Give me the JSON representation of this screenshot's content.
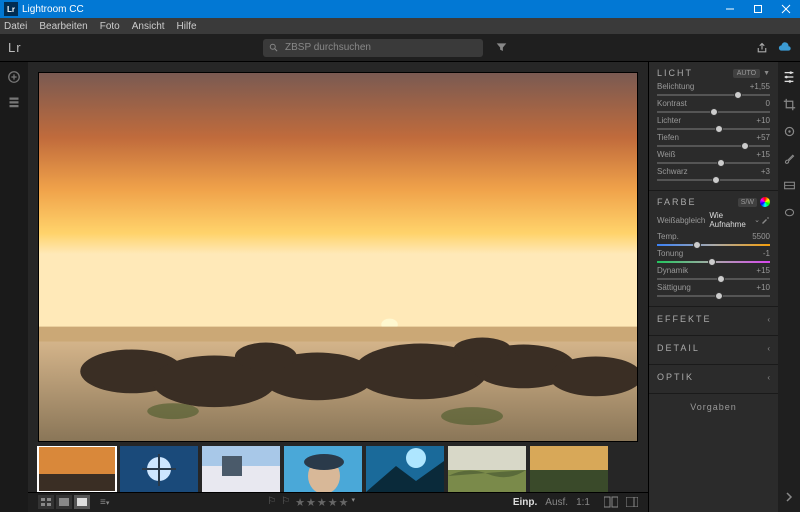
{
  "app": {
    "title": "Lightroom CC",
    "logo": "Lr"
  },
  "menu": [
    "Datei",
    "Bearbeiten",
    "Foto",
    "Ansicht",
    "Hilfe"
  ],
  "search": {
    "placeholder": "ZBSP durchsuchen"
  },
  "panels": {
    "light": {
      "name": "LICHT",
      "auto": "AUTO",
      "sliders": [
        {
          "label": "Belichtung",
          "value": "+1,55",
          "pos": 72
        },
        {
          "label": "Kontrast",
          "value": "0",
          "pos": 50
        },
        {
          "label": "Lichter",
          "value": "+10",
          "pos": 55
        },
        {
          "label": "Tiefen",
          "value": "+57",
          "pos": 78
        },
        {
          "label": "Weiß",
          "value": "+15",
          "pos": 57
        },
        {
          "label": "Schwarz",
          "value": "+3",
          "pos": 52
        }
      ]
    },
    "color": {
      "name": "FARBE",
      "sw": "S/W",
      "wb": {
        "label": "Weißabgleich",
        "value": "Wie Aufnahme"
      },
      "sliders": [
        {
          "label": "Temp.",
          "value": "5500",
          "pos": 35,
          "grad": "temp"
        },
        {
          "label": "Tonung",
          "value": "-1",
          "pos": 49,
          "grad": "tint"
        },
        {
          "label": "Dynamik",
          "value": "+15",
          "pos": 57
        },
        {
          "label": "Sättigung",
          "value": "+10",
          "pos": 55
        }
      ]
    },
    "effects": "EFFEKTE",
    "detail": "DETAIL",
    "optics": "OPTIK",
    "presets": "Vorgaben"
  },
  "bottombar": {
    "fit": "Einp.",
    "output": "Ausf.",
    "ratio": "1:1"
  }
}
